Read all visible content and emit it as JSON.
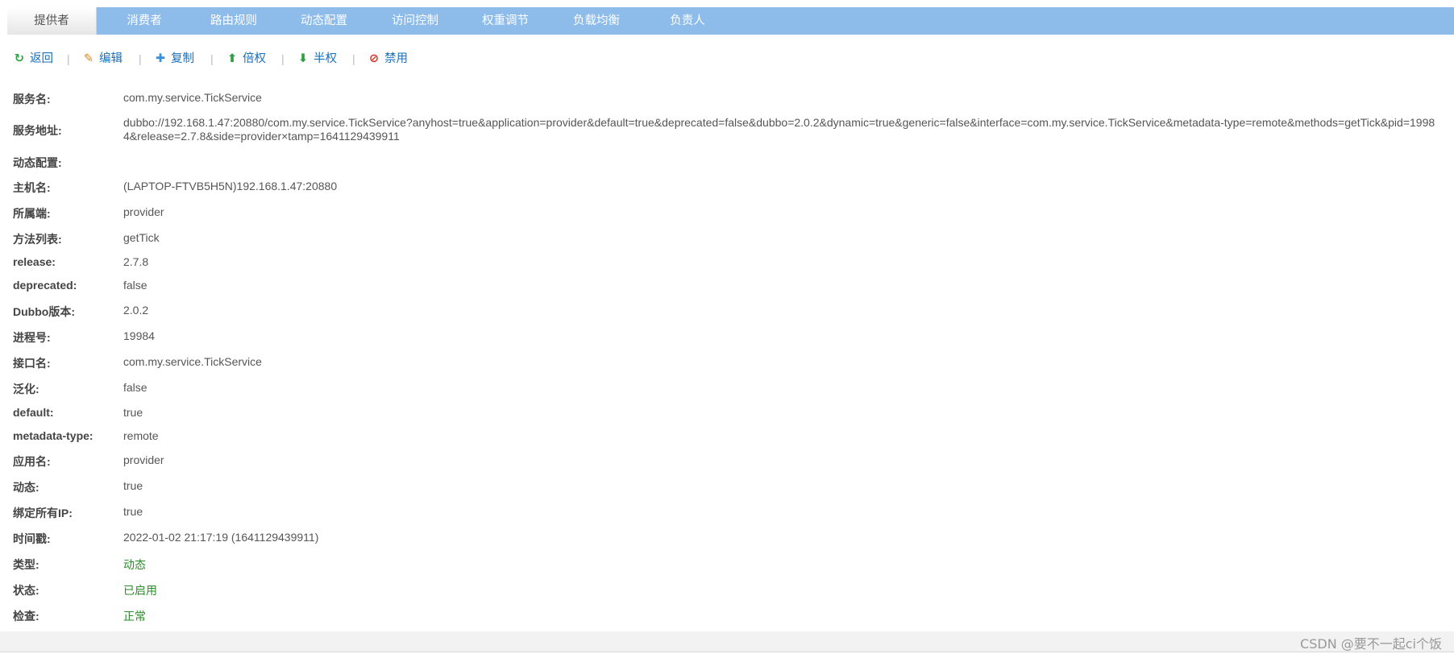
{
  "tabs": [
    "提供者",
    "消费者",
    "路由规则",
    "动态配置",
    "访问控制",
    "权重调节",
    "负载均衡",
    "负责人"
  ],
  "toolbar": {
    "back": "返回",
    "edit": "编辑",
    "copy": "复制",
    "double_weight": "倍权",
    "half_weight": "半权",
    "disable": "禁用",
    "separator": "|"
  },
  "details": [
    {
      "label": "服务名:",
      "value": "com.my.service.TickService"
    },
    {
      "label": "服务地址:",
      "value": "dubbo://192.168.1.47:20880/com.my.service.TickService?anyhost=true&application=provider&default=true&deprecated=false&dubbo=2.0.2&dynamic=true&generic=false&interface=com.my.service.TickService&metadata-type=remote&methods=getTick&pid=19984&release=2.7.8&side=provider×tamp=1641129439911"
    },
    {
      "label": "动态配置:",
      "value": ""
    },
    {
      "label": "主机名:",
      "value": "(LAPTOP-FTVB5H5N)192.168.1.47:20880"
    },
    {
      "label": "所属端:",
      "value": "provider"
    },
    {
      "label": "方法列表:",
      "value": "getTick"
    },
    {
      "label": "release:",
      "value": "2.7.8"
    },
    {
      "label": "deprecated:",
      "value": "false"
    },
    {
      "label": "Dubbo版本:",
      "value": "2.0.2"
    },
    {
      "label": "进程号:",
      "value": "19984"
    },
    {
      "label": "接口名:",
      "value": "com.my.service.TickService"
    },
    {
      "label": "泛化:",
      "value": "false"
    },
    {
      "label": "default:",
      "value": "true"
    },
    {
      "label": "metadata-type:",
      "value": "remote"
    },
    {
      "label": "应用名:",
      "value": "provider"
    },
    {
      "label": "动态:",
      "value": "true"
    },
    {
      "label": "绑定所有IP:",
      "value": "true"
    },
    {
      "label": "时间戳:",
      "value": "2022-01-02 21:17:19 (1641129439911)"
    },
    {
      "label": "类型:",
      "value": "动态"
    },
    {
      "label": "状态:",
      "value": "已启用"
    },
    {
      "label": "检查:",
      "value": "正常"
    }
  ],
  "watermark": "CSDN @要不一起ci个饭",
  "colors": {
    "tabbar": "#8dbceb",
    "link": "#1a6fb8",
    "status_green": "#2a8c2a"
  }
}
